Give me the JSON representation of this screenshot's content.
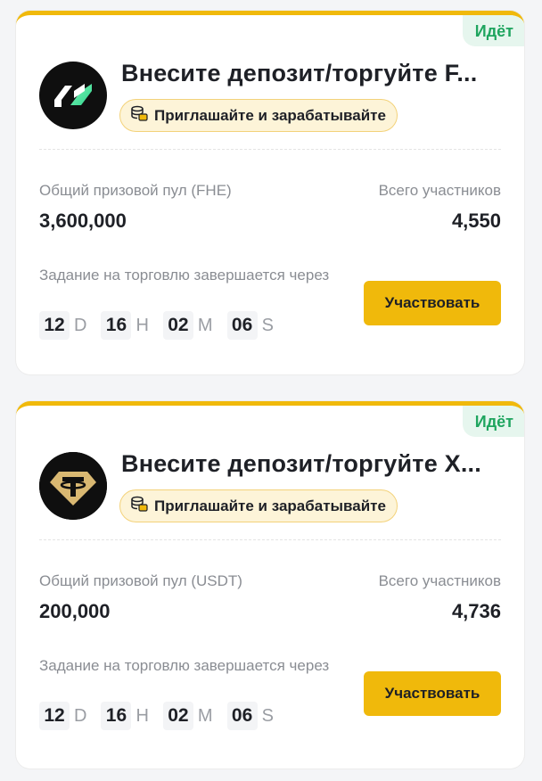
{
  "cards": [
    {
      "status": "Идёт",
      "logo_icon": "fhe-logo-icon",
      "title": "Внесите депозит/торгуйте F...",
      "promo_label": "Приглашайте и зарабатывайте",
      "pool_label": "Общий призовой пул (FHE)",
      "pool_value": "3,600,000",
      "participants_label": "Всего участников",
      "participants_value": "4,550",
      "ends_label": "Задание на торговлю завершается через",
      "countdown": [
        {
          "value": "12",
          "unit": "D"
        },
        {
          "value": "16",
          "unit": "H"
        },
        {
          "value": "02",
          "unit": "M"
        },
        {
          "value": "06",
          "unit": "S"
        }
      ],
      "button_label": "Участвовать"
    },
    {
      "status": "Идёт",
      "logo_icon": "tether-logo-icon",
      "title": "Внесите депозит/торгуйте X...",
      "promo_label": "Приглашайте и зарабатывайте",
      "pool_label": "Общий призовой пул (USDT)",
      "pool_value": "200,000",
      "participants_label": "Всего участников",
      "participants_value": "4,736",
      "ends_label": "Задание на торговлю завершается через",
      "countdown": [
        {
          "value": "12",
          "unit": "D"
        },
        {
          "value": "16",
          "unit": "H"
        },
        {
          "value": "02",
          "unit": "M"
        },
        {
          "value": "06",
          "unit": "S"
        }
      ],
      "button_label": "Участвовать"
    }
  ],
  "colors": {
    "accent": "#f0b90b",
    "status_green": "#1fa55f",
    "status_bg": "#e6f6ee"
  }
}
